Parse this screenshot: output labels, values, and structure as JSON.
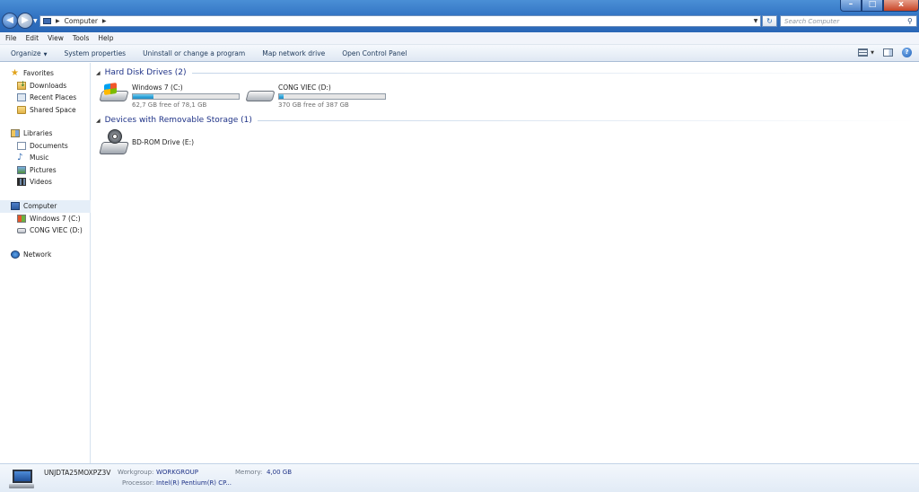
{
  "window": {
    "minimize_glyph": "–",
    "maximize_glyph": "□",
    "close_glyph": "x"
  },
  "address": {
    "path": "Computer",
    "search_placeholder": "Search Computer"
  },
  "menu": [
    "File",
    "Edit",
    "View",
    "Tools",
    "Help"
  ],
  "commands": {
    "organize": "Organize",
    "items": [
      "System properties",
      "Uninstall or change a program",
      "Map network drive",
      "Open Control Panel"
    ]
  },
  "nav": {
    "favorites": {
      "label": "Favorites",
      "items": [
        "Downloads",
        "Recent Places",
        "Shared Space"
      ]
    },
    "libraries": {
      "label": "Libraries",
      "items": [
        "Documents",
        "Music",
        "Pictures",
        "Videos"
      ]
    },
    "computer": {
      "label": "Computer",
      "items": [
        "Windows 7 (C:)",
        "CONG VIEC (D:)"
      ]
    },
    "network": {
      "label": "Network"
    }
  },
  "groups": {
    "hdd": {
      "title": "Hard Disk Drives (2)",
      "drives": [
        {
          "name": "Windows 7 (C:)",
          "free_text": "62,7 GB free of 78,1 GB",
          "used_fraction": 0.197
        },
        {
          "name": "CONG VIEC (D:)",
          "free_text": "370 GB free of 387 GB",
          "used_fraction": 0.044
        }
      ]
    },
    "removable": {
      "title": "Devices with Removable Storage (1)",
      "devices": [
        {
          "name": "BD-ROM Drive (E:)"
        }
      ]
    }
  },
  "details": {
    "computer_name": "UNJDTA25MOXPZ3V",
    "workgroup_label": "Workgroup:",
    "workgroup_value": "WORKGROUP",
    "memory_label": "Memory:",
    "memory_value": "4,00 GB",
    "processor_label": "Processor:",
    "processor_value": "Intel(R) Pentium(R) CP..."
  },
  "colors": {
    "group_title": "#1e3287",
    "bar_fill": "#2ba0d8",
    "titlebar": "#2e6fc0"
  }
}
